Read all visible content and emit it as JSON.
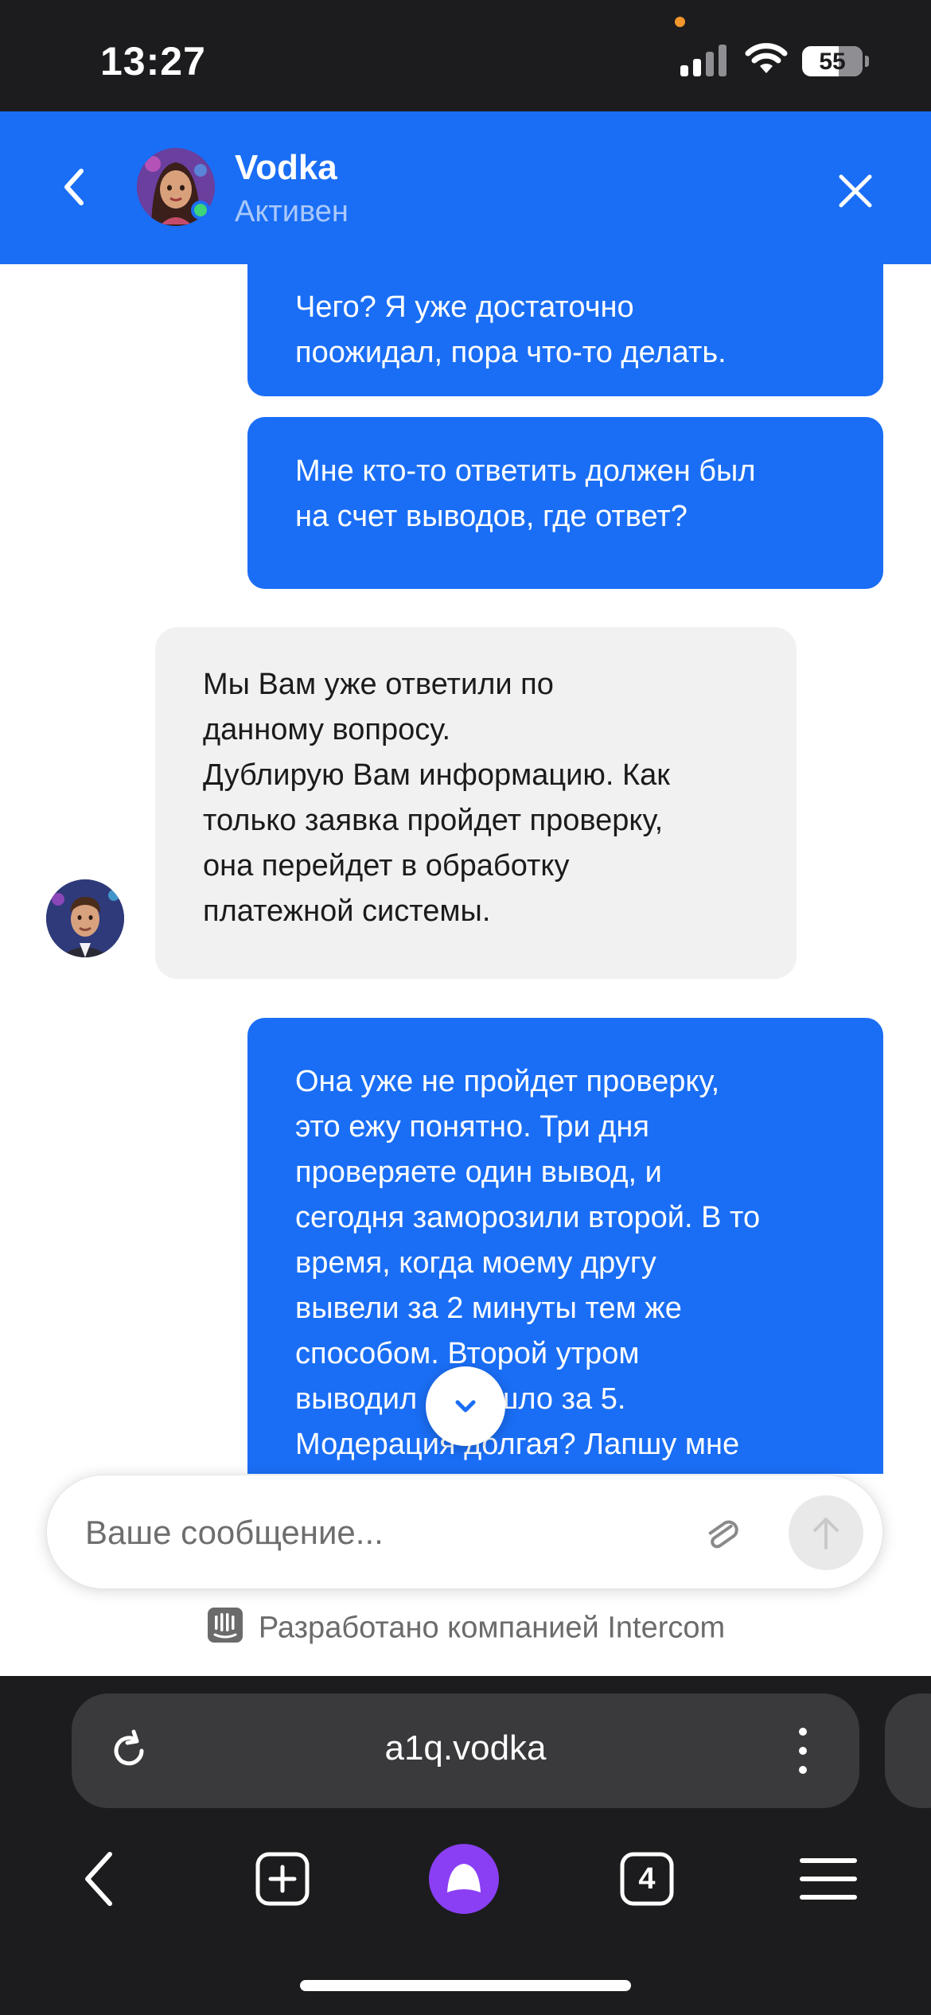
{
  "status_bar": {
    "time": "13:27",
    "battery": "55",
    "icons": [
      "cellular-signal-icon",
      "wifi-icon",
      "battery-icon"
    ],
    "dot_color": "#f2962c"
  },
  "header": {
    "name": "Vodka",
    "status": "Активен",
    "back_icon": "chevron-left-icon",
    "close_icon": "close-icon",
    "color": "#1a6ef5"
  },
  "messages": [
    {
      "from": "user",
      "text": "Чего? Я уже достаточно\nпоожидал, пора что-то делать."
    },
    {
      "from": "user",
      "text": "Мне кто-то ответить должен был\nна счет выводов, где ответ?"
    },
    {
      "from": "agent",
      "text": "Мы Вам уже ответили по\nданному вопросу.\nДублирую Вам информацию. Как\nтолько заявка пройдет проверку,\nона перейдет в обработку\nплатежной системы."
    },
    {
      "from": "user",
      "text": "Она уже не пройдет проверку,\nэто ежу понятно. Три дня\nпроверяете один вывод, и\nсегодня заморозили второй. В то\nвремя, когда моему другу\nвывели за 2 минуты тем же\nспособом. Второй утром\nвыводил - пришло за 5.\nМодерация долгая? Лапшу мне"
    }
  ],
  "composer": {
    "placeholder": "Ваше сообщение...",
    "attach_icon": "paperclip-icon",
    "send_icon": "send-arrow-icon"
  },
  "footer": {
    "powered_by": "Разработано компанией Intercom"
  },
  "browser": {
    "url": "a1q.vodka",
    "tab_count": "4",
    "nav_icons": [
      "back-arrow-icon",
      "new-tab-icon",
      "alice-assistant-icon",
      "tabs-icon",
      "menu-icon"
    ]
  }
}
